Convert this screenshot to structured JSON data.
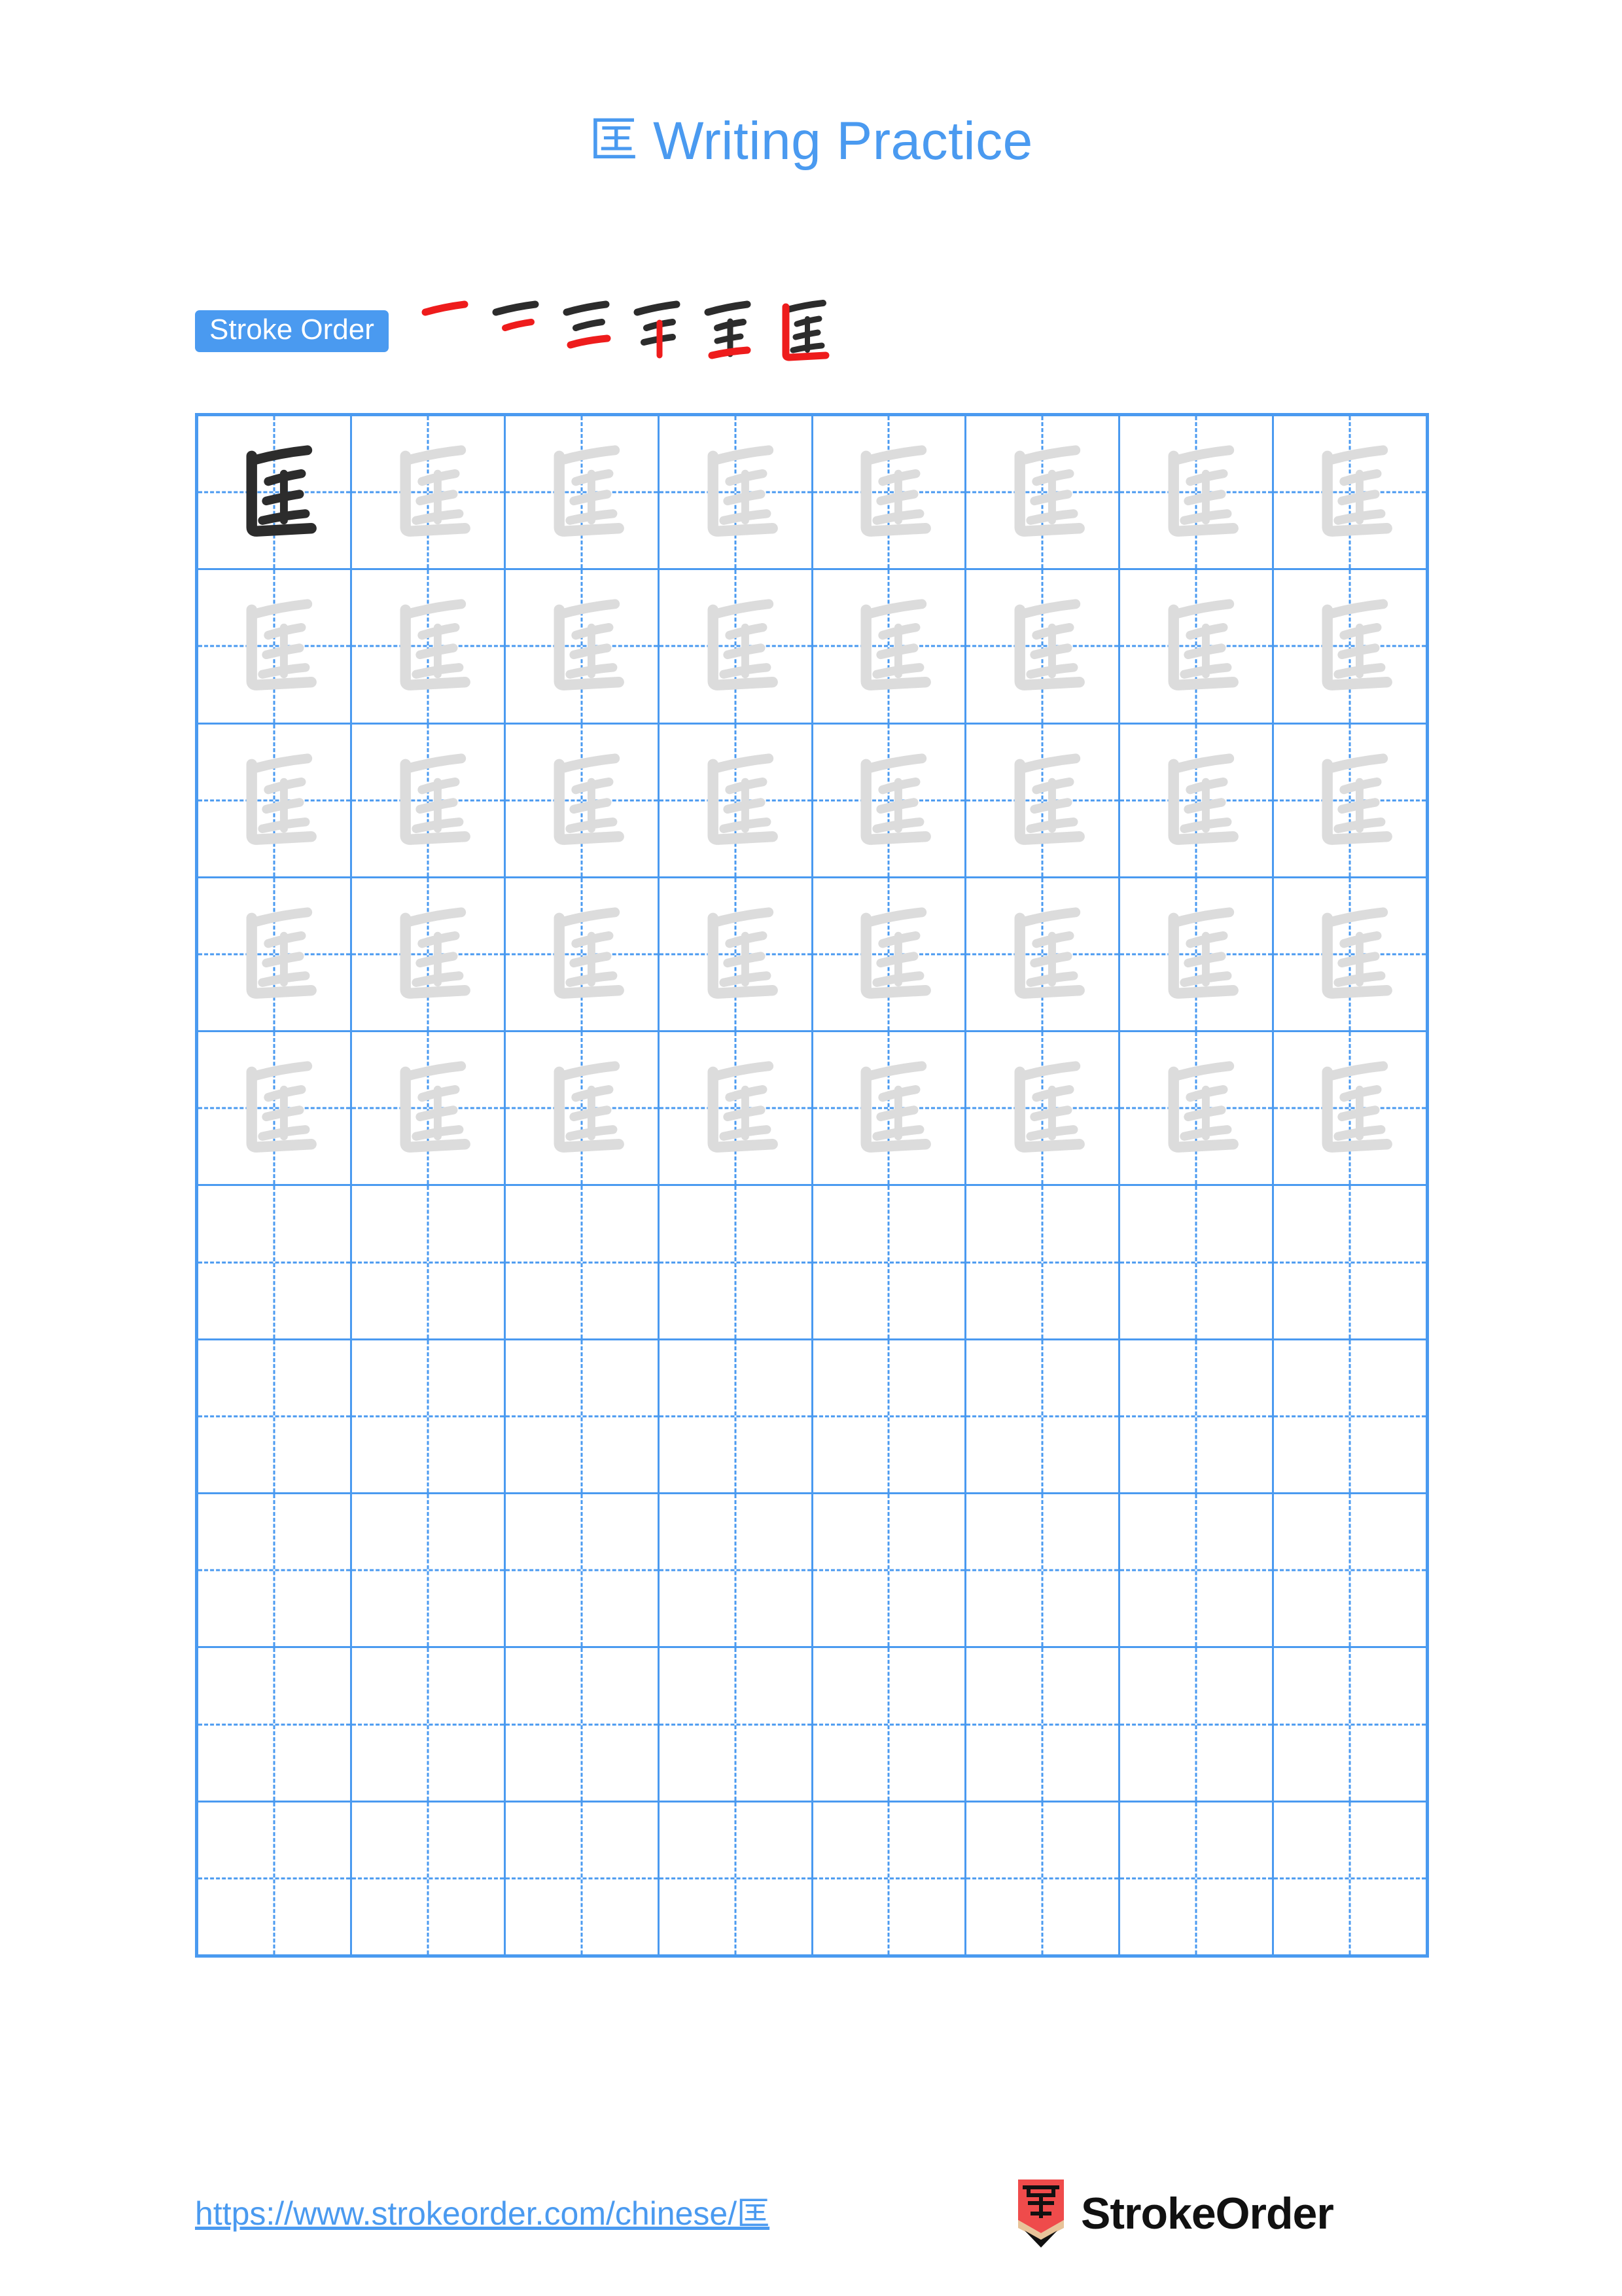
{
  "document": {
    "character": "匡",
    "title_text": "Writing Practice",
    "title_full": "匡 Writing Practice",
    "accent_color": "#4a9af0",
    "trace_color": "#dcdcdc",
    "ink_color": "#2c2c2c",
    "highlight_color": "#ee1c1c",
    "background_color": "#ffffff"
  },
  "stroke_order": {
    "badge_label": "Stroke Order",
    "stroke_count": 6,
    "steps": [
      {
        "index": 1,
        "strokes_shown": 1,
        "new_stroke": "heng (top horizontal)"
      },
      {
        "index": 2,
        "strokes_shown": 2,
        "new_stroke": "heng (second horizontal)"
      },
      {
        "index": 3,
        "strokes_shown": 3,
        "new_stroke": "heng (third horizontal)"
      },
      {
        "index": 4,
        "strokes_shown": 4,
        "new_stroke": "shu (vertical)"
      },
      {
        "index": 5,
        "strokes_shown": 5,
        "new_stroke": "heng (bottom horizontal of 王)"
      },
      {
        "index": 6,
        "strokes_shown": 6,
        "new_stroke": "shu-zhe (enclosing 匚 radical)"
      }
    ]
  },
  "grid": {
    "columns": 8,
    "rows": 10,
    "filled_rows": 5,
    "blank_rows": 5,
    "row_kinds": [
      "model-then-trace",
      "trace",
      "trace",
      "trace",
      "trace",
      "blank",
      "blank",
      "blank",
      "blank",
      "blank"
    ]
  },
  "footer": {
    "url": "https://www.strokeorder.com/chinese/匡",
    "brand_name": "StrokeOrder",
    "brand_mark_character": "字",
    "brand_mark_body_color": "#ef4b4b",
    "brand_mark_wood_color": "#e8c49a",
    "brand_mark_tip_color": "#111111"
  }
}
